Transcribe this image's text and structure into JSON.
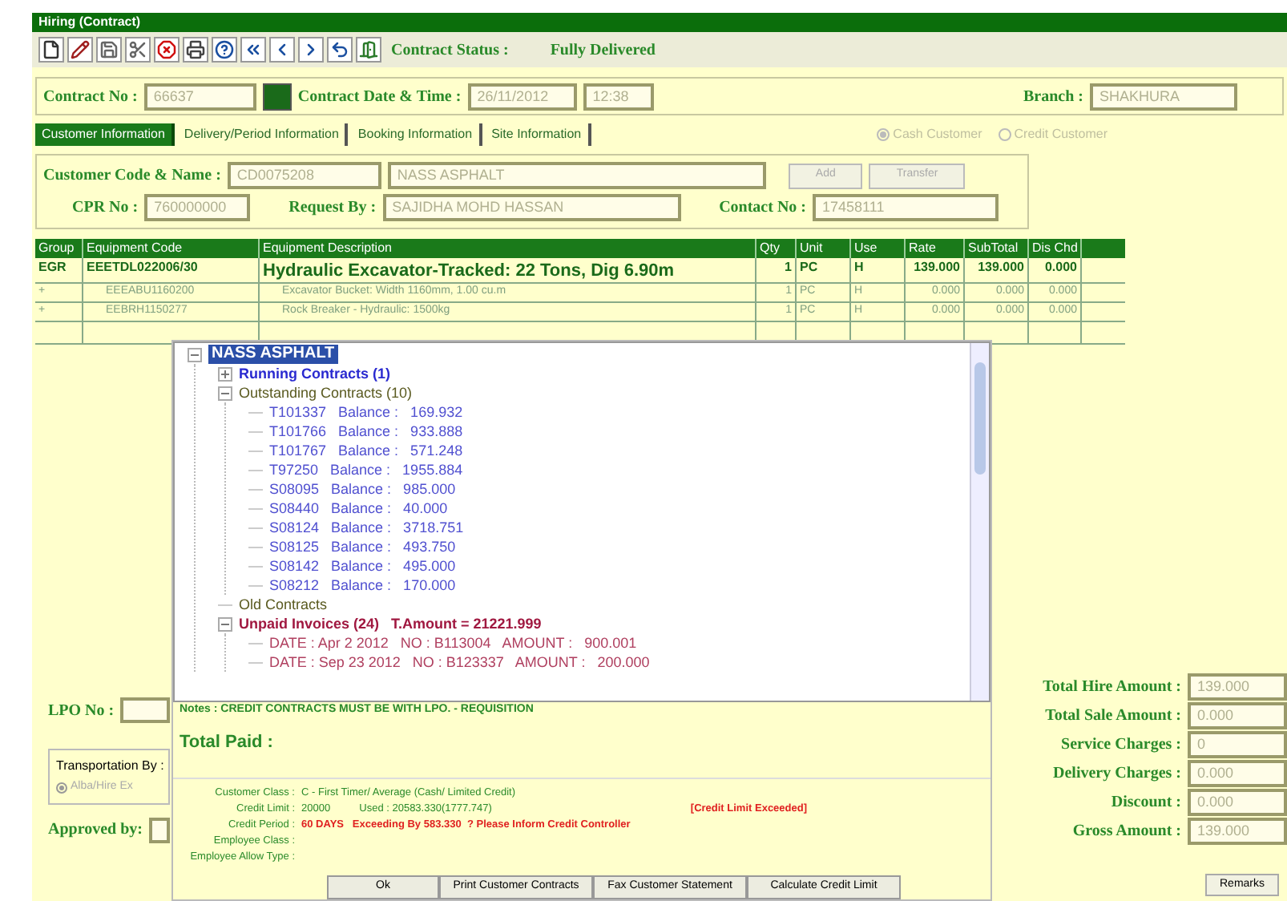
{
  "window": {
    "title": "Hiring (Contract)"
  },
  "toolbar": {
    "status_label": "Contract Status :",
    "status_value": "Fully Delivered"
  },
  "header": {
    "contract_no_label": "Contract No :",
    "contract_no": "66637",
    "date_label": "Contract Date & Time :",
    "date": "26/11/2012",
    "time": "12:38",
    "branch_label": "Branch :",
    "branch": "SHAKHURA"
  },
  "tabs": [
    {
      "label": "Customer Information",
      "selected": true
    },
    {
      "label": "Delivery/Period Information",
      "selected": false
    },
    {
      "label": "Booking Information",
      "selected": false
    },
    {
      "label": "Site Information",
      "selected": false
    }
  ],
  "customer_type": [
    {
      "label": "Cash Customer",
      "selected": true,
      "disabled": true
    },
    {
      "label": "Credit Customer",
      "selected": false,
      "disabled": true
    }
  ],
  "customer": {
    "code_label": "Customer Code & Name :",
    "code": "CD0075208",
    "name": "NASS ASPHALT",
    "buttons": [
      "Add",
      "Transfer"
    ],
    "cpr_label": "CPR No :",
    "cpr": "760000000",
    "request_label": "Request By :",
    "request_by": "SAJIDHA MOHD HASSAN",
    "contact_label": "Contact No :",
    "contact": "17458111"
  },
  "table": {
    "columns": [
      "Group",
      "Equipment Code",
      "Equipment Description",
      "Qty",
      "Unit",
      "Use",
      "Rate",
      "SubTotal",
      "Dis Chd"
    ],
    "rows": [
      {
        "main": true,
        "cells": [
          "EGR",
          "EEETDL022006/30",
          "Hydraulic Excavator-Tracked: 22 Tons, Dig 6.90m",
          "1",
          "PC",
          "H",
          "139.000",
          "139.000",
          "0.000"
        ]
      },
      {
        "main": false,
        "cells": [
          "+",
          "EEEABU1160200",
          "Excavator Bucket: Width 1160mm, 1.00 cu.m",
          "1",
          "PC",
          "H",
          "0.000",
          "0.000",
          "0.000"
        ]
      },
      {
        "main": false,
        "cells": [
          "+",
          "EEBRH1150277",
          "Rock Breaker - Hydraulic: 1500kg",
          "1",
          "PC",
          "H",
          "0.000",
          "0.000",
          "0.000"
        ]
      }
    ]
  },
  "tree": {
    "label": "NASS ASPHALT",
    "selected": true,
    "expanded": true,
    "children": [
      {
        "label": "Running Contracts (1)",
        "color": "#2a2ad0",
        "bold": true,
        "expanded": false
      },
      {
        "label": "Outstanding Contracts (10)",
        "color": "#5a5a20",
        "bold": false,
        "expanded": true,
        "children": [
          {
            "label": "T101337   Balance :   169.932",
            "color": "#5050d0"
          },
          {
            "label": "T101766   Balance :   933.888",
            "color": "#5050d0"
          },
          {
            "label": "T101767   Balance :   571.248",
            "color": "#5050d0"
          },
          {
            "label": "T97250   Balance :   1955.884",
            "color": "#5050d0"
          },
          {
            "label": "S08095   Balance :   985.000",
            "color": "#5050d0"
          },
          {
            "label": "S08440   Balance :   40.000",
            "color": "#5050d0"
          },
          {
            "label": "S08124   Balance :   3718.751",
            "color": "#5050d0"
          },
          {
            "label": "S08125   Balance :   493.750",
            "color": "#5050d0"
          },
          {
            "label": "S08142   Balance :   495.000",
            "color": "#5050d0"
          },
          {
            "label": "S08212   Balance :   170.000",
            "color": "#5050d0"
          }
        ]
      },
      {
        "label": "Old Contracts",
        "color": "#5a5a20",
        "bold": false
      },
      {
        "label": "Unpaid Invoices (24)   T.Amount = 21221.999",
        "color": "#a01840",
        "bold": true,
        "expanded": true,
        "children": [
          {
            "label": "DATE : Apr 2 2012   NO : B113004   AMOUNT :   900.001",
            "color": "#b04060"
          },
          {
            "label": "DATE : Sep 23 2012   NO : B123337   AMOUNT :   200.000",
            "color": "#b04060"
          }
        ]
      }
    ]
  },
  "popup": {
    "notes": "Notes : CREDIT CONTRACTS MUST BE WITH LPO. - REQUISITION",
    "total_paid": "Total Paid :",
    "info": [
      {
        "label": "Customer Class :",
        "value": "C - First Timer/ Average (Cash/ Limited Credit)"
      },
      {
        "label": "Credit Limit :",
        "value": "20000          Used : 20583.330(1777.747)",
        "alert": "[Credit Limit Exceeded]"
      },
      {
        "label": "Credit Period :",
        "value": "60 DAYS   Exceeding By 583.330  ? Please Inform Credit Controller",
        "warning": true
      },
      {
        "label": "Employee Class :"
      },
      {
        "label": "Employee Allow Type :"
      }
    ],
    "buttons": [
      "Ok",
      "Print Customer Contracts",
      "Fax Customer Statement",
      "Calculate Credit Limit"
    ]
  },
  "left": {
    "lpo_label": "LPO No :",
    "transport_label": "Transportation By :",
    "transport_option": {
      "label": "Alba/Hire Ex",
      "selected": true
    },
    "approved_label": "Approved by:"
  },
  "totals": [
    {
      "label": "Total Hire Amount :",
      "value": "139.000"
    },
    {
      "label": "Total Sale Amount :",
      "value": "0.000"
    },
    {
      "label": "Service Charges :",
      "value": "0"
    },
    {
      "label": "Delivery Charges :",
      "value": "0.000"
    },
    {
      "label": "Discount :",
      "value": "0.000"
    },
    {
      "label": "Gross Amount :",
      "value": "139.000"
    }
  ],
  "remarks_button": "Remarks"
}
